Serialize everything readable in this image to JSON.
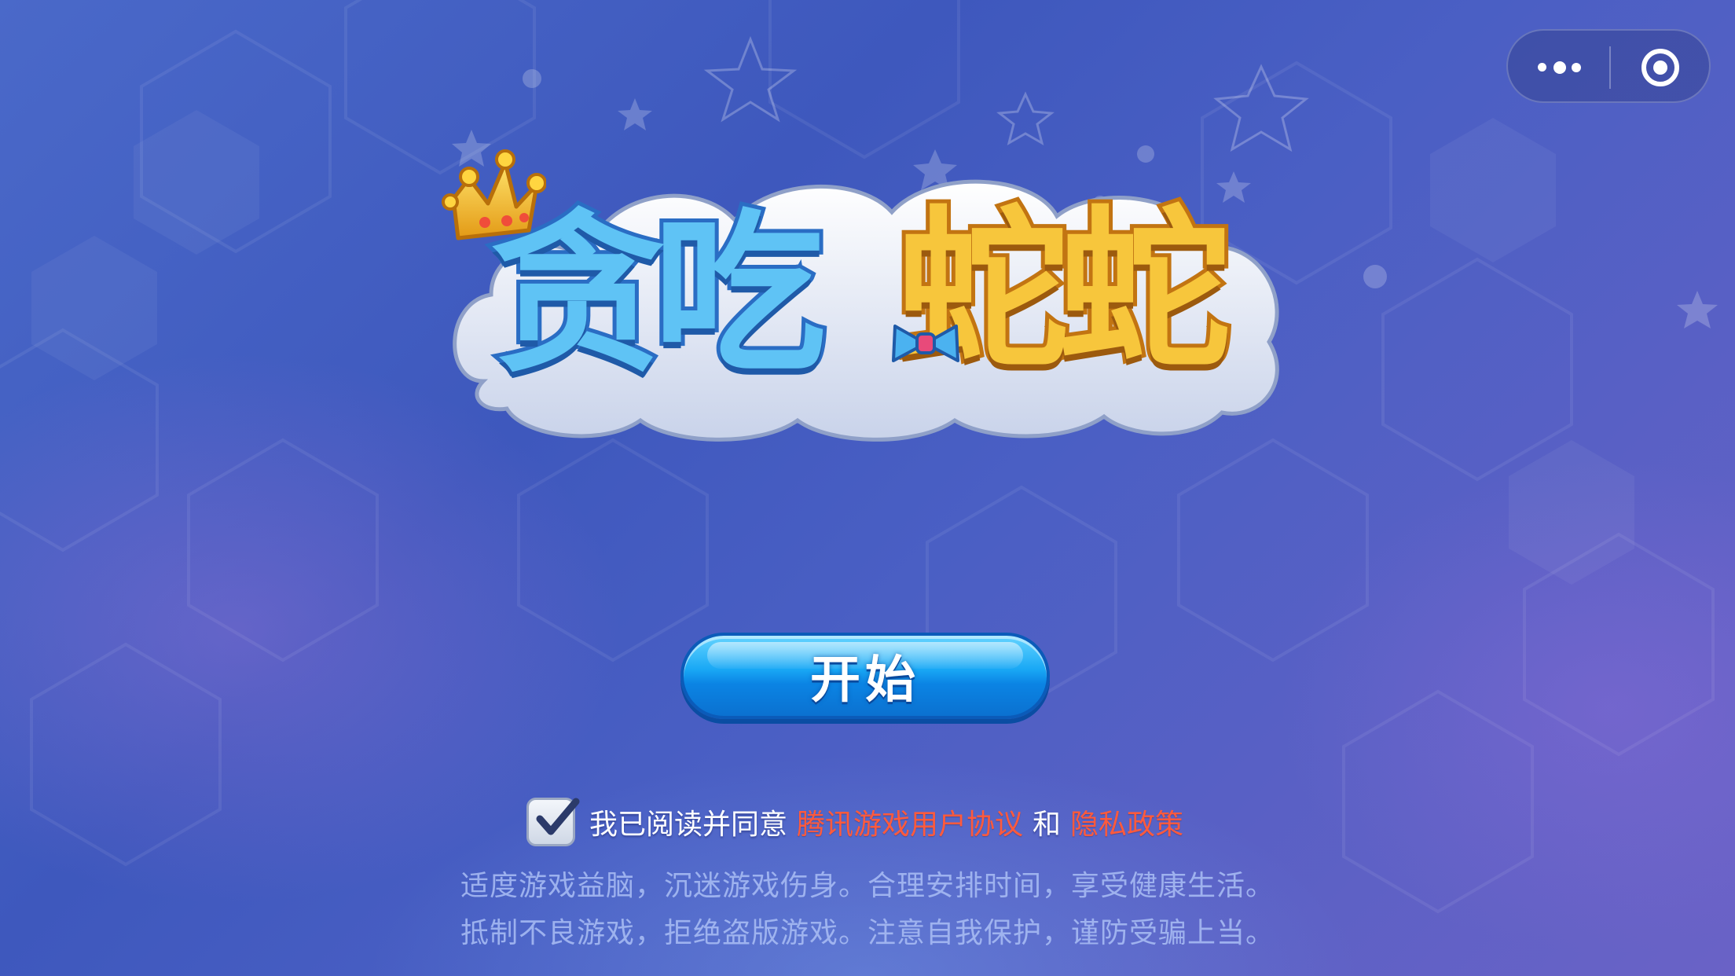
{
  "window": {
    "more_icon": "more-dots-icon",
    "close_icon": "target-close-icon"
  },
  "logo": {
    "title_blue": "贪吃",
    "title_gold": "蛇蛇",
    "icons": [
      "crown-icon",
      "bow-icon",
      "cloud"
    ]
  },
  "start_button": {
    "label": "开始"
  },
  "agreement": {
    "checked": true,
    "prefix": "我已阅读并同意",
    "terms_link": "腾讯游戏用户协议",
    "conjunction": "和",
    "privacy_link": "隐私政策"
  },
  "health_notice": {
    "line1": "适度游戏益脑，沉迷游戏伤身。合理安排时间，享受健康生活。",
    "line2": "抵制不良游戏，拒绝盗版游戏。注意自我保护，谨防受骗上当。"
  },
  "colors": {
    "background": "#4a64c6",
    "button": "#19a8f5",
    "link": "#ff5a3c",
    "title_blue": "#5fc3f5",
    "title_gold": "#f7c63c"
  }
}
